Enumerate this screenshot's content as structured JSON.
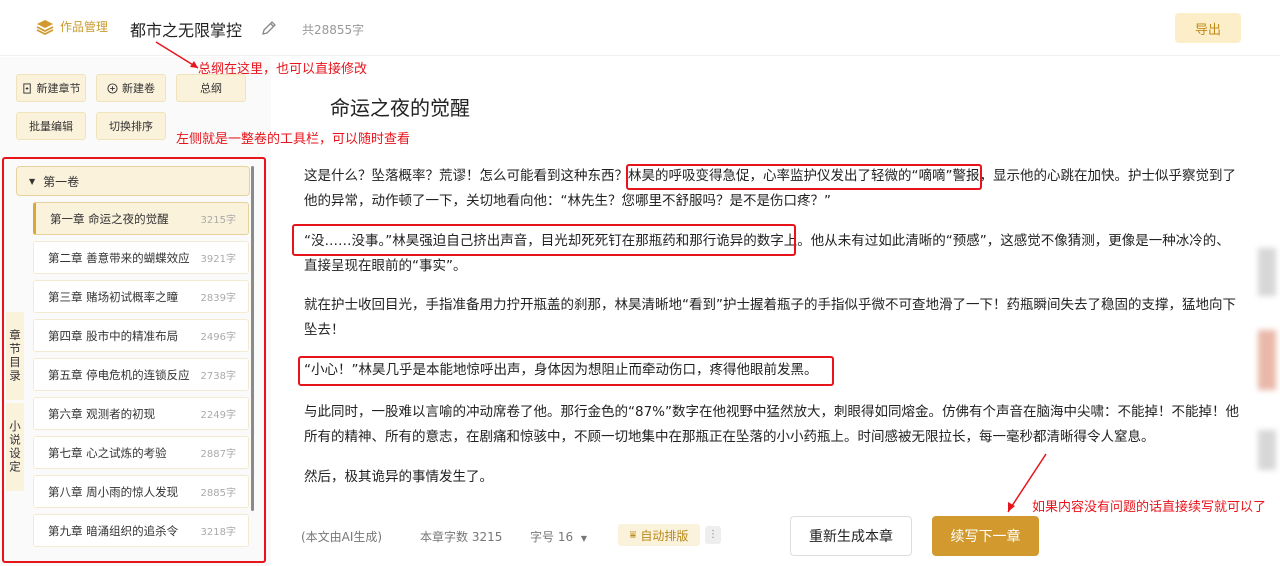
{
  "header": {
    "brand_label": "作品管理",
    "book_title": "都市之无限掌控",
    "word_count": "共28855字",
    "export_label": "导出"
  },
  "toolbar": {
    "new_chapter": "新建章节",
    "new_volume": "新建卷",
    "outline": "总纲",
    "batch_edit": "批量编辑",
    "toggle_sort": "切换排序"
  },
  "volume": {
    "label": "第一卷"
  },
  "chapters": [
    {
      "title": "第一章 命运之夜的觉醒",
      "count": "3215字"
    },
    {
      "title": "第二章 善意带来的蝴蝶效应",
      "count": "3921字"
    },
    {
      "title": "第三章 赌场初试概率之瞳",
      "count": "2839字"
    },
    {
      "title": "第四章 股市中的精准布局",
      "count": "2496字"
    },
    {
      "title": "第五章 停电危机的连锁反应",
      "count": "2738字"
    },
    {
      "title": "第六章 观测者的初现",
      "count": "2249字"
    },
    {
      "title": "第七章 心之试炼的考验",
      "count": "2887字"
    },
    {
      "title": "第八章 周小雨的惊人发现",
      "count": "2885字"
    },
    {
      "title": "第九章 暗涌组织的追杀令",
      "count": "3218字"
    }
  ],
  "side_tabs": {
    "chapter_directory": "章节目录",
    "novel_settings": "小说设定"
  },
  "annotations": {
    "outline_note": "总纲在这里，也可以直接修改",
    "toolbar_note": "左侧就是一整卷的工具栏，可以随时查看",
    "continue_note": "如果内容没有问题的话直接续写就可以了"
  },
  "editor": {
    "chapter_title": "命运之夜的觉醒",
    "paragraphs": [
      "这是什么？坠落概率？荒谬！怎么可能看到这种东西？林昊的呼吸变得急促，心率监护仪发出了轻微的“嘀嘀”警报，显示他的心跳在加快。护士似乎察觉到了他的异常，动作顿了一下，关切地看向他：“林先生？您哪里不舒服吗？是不是伤口疼？”",
      "“没……没事。”林昊强迫自己挤出声音，目光却死死钉在那瓶药和那行诡异的数字上。他从未有过如此清晰的“预感”，这感觉不像猜测，更像是一种冰冷的、直接呈现在眼前的“事实”。",
      "就在护士收回目光，手指准备用力拧开瓶盖的刹那，林昊清晰地“看到”护士握着瓶子的手指似乎微不可查地滑了一下！药瓶瞬间失去了稳固的支撑，猛地向下坠去！",
      "“小心！”林昊几乎是本能地惊呼出声，身体因为想阻止而牵动伤口，疼得他眼前发黑。",
      "与此同时，一股难以言喻的冲动席卷了他。那行金色的“87%”数字在他视野中猛然放大，刺眼得如同熔金。仿佛有个声音在脑海中尖啸：不能掉！不能掉！他所有的精神、所有的意志，在剧痛和惊骇中，不顾一切地集中在那瓶正在坠落的小小药瓶上。时间感被无限拉长，每一毫秒都清晰得令人窒息。",
      "然后，极其诡异的事情发生了。"
    ]
  },
  "footer": {
    "ai_note": "(本文由AI生成)",
    "chapter_words_label": "本章字数 3215",
    "font_size_label": "字号 16",
    "auto_layout": "自动排版",
    "more": "⋮",
    "regenerate": "重新生成本章",
    "continue_next": "续写下一章"
  },
  "colors": {
    "accent": "#d29a2e",
    "accent_light": "#fbf2dc",
    "annotation_red": "#e8141c"
  }
}
